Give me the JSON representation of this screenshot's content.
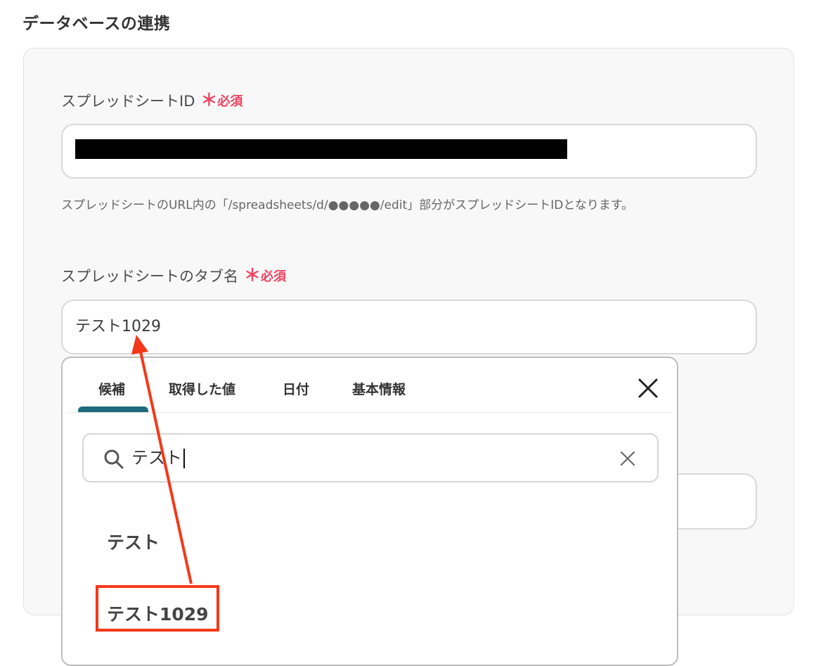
{
  "section": {
    "title": "データベースの連携"
  },
  "spreadsheet_id": {
    "label": "スプレッドシートID",
    "required_mark": "＊",
    "required_text": "必須",
    "help": "スプレッドシートのURL内の「/spreadsheets/d/●●●●●/edit」部分がスプレッドシートIDとなります。"
  },
  "tab_name": {
    "label": "スプレッドシートのタブ名",
    "required_mark": "＊",
    "required_text": "必須",
    "value": "テスト1029"
  },
  "dropdown": {
    "tabs": [
      "候補",
      "取得した値",
      "日付",
      "基本情報"
    ],
    "active_tab": "候補",
    "search_value": "テスト",
    "options": [
      "テスト",
      "テスト1029"
    ],
    "highlighted_option": "テスト1029"
  },
  "colors": {
    "required": "#ee4462",
    "active_tab": "#1f6b7e",
    "annotation": "#f53818"
  }
}
